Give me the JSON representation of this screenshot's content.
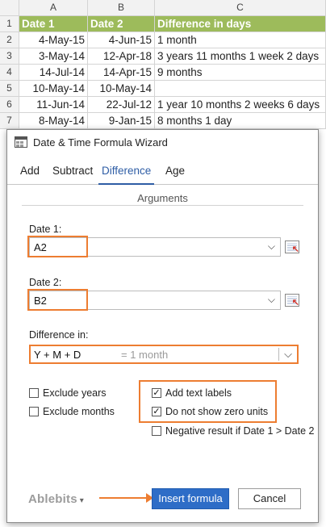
{
  "sheet": {
    "col_headers": [
      "A",
      "B",
      "C"
    ],
    "rows": [
      {
        "num": "1",
        "a": "Date 1",
        "b": "Date 2",
        "c": "Difference in days"
      },
      {
        "num": "2",
        "a": "4-May-15",
        "b": "4-Jun-15",
        "c": "1 month"
      },
      {
        "num": "3",
        "a": "3-May-14",
        "b": "12-Apr-18",
        "c": "3 years 11 months 1 week 2 days"
      },
      {
        "num": "4",
        "a": "14-Jul-14",
        "b": "14-Apr-15",
        "c": "9 months"
      },
      {
        "num": "5",
        "a": "10-May-14",
        "b": "10-May-14",
        "c": ""
      },
      {
        "num": "6",
        "a": "11-Jun-14",
        "b": "22-Jul-12",
        "c": "1 year 10 months 2 weeks 6 days"
      },
      {
        "num": "7",
        "a": "8-May-14",
        "b": "9-Jan-15",
        "c": "8 months 1 day"
      }
    ],
    "header_color": "#9dbb5b"
  },
  "dialog": {
    "title": "Date & Time Formula Wizard",
    "tabs": [
      "Add",
      "Subtract",
      "Difference",
      "Age"
    ],
    "active_tab": "Difference",
    "group_title": "Arguments",
    "date1_label": "Date 1:",
    "date1_value": "A2",
    "date2_label": "Date 2:",
    "date2_value": "B2",
    "difference_label": "Difference in:",
    "difference_value": "Y + M + D",
    "difference_hint": "= 1 month",
    "checkboxes": {
      "exclude_years": {
        "label": "Exclude years",
        "checked": false
      },
      "exclude_months": {
        "label": "Exclude months",
        "checked": false
      },
      "add_text_labels": {
        "label": "Add text labels",
        "checked": true
      },
      "no_zero_units": {
        "label": "Do not show zero units",
        "checked": true
      },
      "negative_result": {
        "label": "Negative result if Date 1 > Date 2",
        "checked": false
      }
    },
    "brand": "Ablebits",
    "insert_label": "Insert formula",
    "cancel_label": "Cancel",
    "accent": "#2e6dc7",
    "highlight": "#ed7d31"
  }
}
